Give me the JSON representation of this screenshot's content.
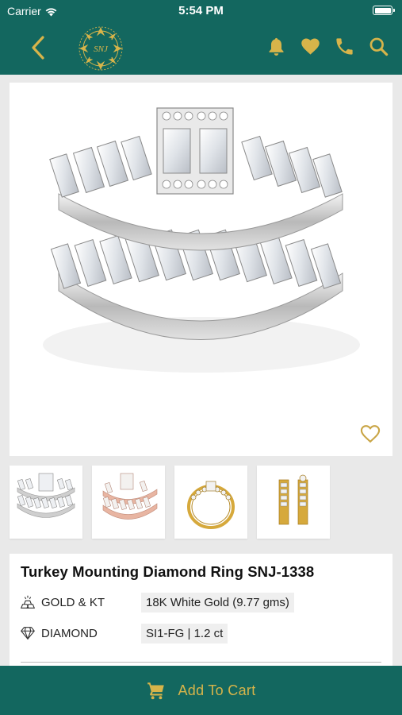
{
  "status_bar": {
    "carrier": "Carrier",
    "time": "5:54 PM"
  },
  "header": {
    "brand_logo_text": "SNJ",
    "icons": [
      "back-arrow-icon",
      "bell-icon",
      "heart-icon",
      "phone-icon",
      "search-icon"
    ],
    "background_color": "#13675f",
    "accent_color": "#d7b44a"
  },
  "product": {
    "title": "Turkey Mounting Diamond Ring SNJ-1338",
    "specs": [
      {
        "icon": "gold-bars-icon",
        "label": "GOLD & KT",
        "value": "18K White Gold (9.77 gms)"
      },
      {
        "icon": "diamond-icon",
        "label": "DIAMOND",
        "value": "SI1-FG | 1.2 ct"
      }
    ],
    "thumbnails": [
      "white-gold-ring-set",
      "rose-gold-ring-set",
      "yellow-gold-ring",
      "yellow-gold-ring-band-pair"
    ]
  },
  "cart": {
    "label": "Add To Cart"
  }
}
